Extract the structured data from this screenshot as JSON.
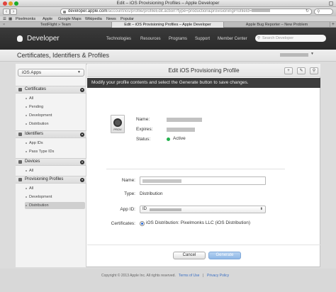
{
  "window": {
    "title": "Edit – iOS Provisioning Profiles – Apple Developer"
  },
  "browser": {
    "address_host": "developer.apple.com",
    "address_path": "/account/ios/profile/profileEdit.action?type=production&provisioningProfileId=",
    "bookmarks": [
      "Pixelmonks",
      "Apple",
      "Google Maps",
      "Wikipedia",
      "News",
      "Popular"
    ],
    "tabs": [
      "TestFlight » Team",
      "Edit – iOS Provisioning Profiles – Apple Developer",
      "Apple Bug Reporter – New Problem"
    ]
  },
  "header": {
    "brand": "Developer",
    "nav": [
      "Technologies",
      "Resources",
      "Programs",
      "Support",
      "Member Center"
    ],
    "search_placeholder": "Search Developer"
  },
  "section": {
    "title": "Certificates, Identifiers & Profiles"
  },
  "sidebar": {
    "platform": "iOS Apps",
    "groups": [
      {
        "label": "Certificates",
        "items": [
          "All",
          "Pending",
          "Development",
          "Distribution"
        ]
      },
      {
        "label": "Identifiers",
        "items": [
          "App IDs",
          "Pass Type IDs"
        ]
      },
      {
        "label": "Devices",
        "items": [
          "All"
        ]
      },
      {
        "label": "Provisioning Profiles",
        "items": [
          "All",
          "Development",
          "Distribution"
        ]
      }
    ]
  },
  "content": {
    "title": "Edit iOS Provisioning Profile",
    "banner": "Modify your profile contents and select the Generate button to save changes.",
    "icon_label": "PROV",
    "info_labels": {
      "name": "Name:",
      "expires": "Expires:",
      "status": "Status:"
    },
    "status_value": "Active",
    "status_color": "#22b14c",
    "form": {
      "name_label": "Name:",
      "type_label": "Type:",
      "type_value": "Distribution",
      "appid_label": "App ID:",
      "appid_prefix": "ID",
      "cert_label": "Certificates:",
      "cert_value": "iOS Distribution: Pixelmonks LLC (iOS Distribution)"
    },
    "cancel": "Cancel",
    "generate": "Generate"
  },
  "footer": {
    "copyright": "Copyright © 2013 Apple Inc. All rights reserved.",
    "terms": "Terms of Use",
    "privacy": "Privacy Policy"
  }
}
